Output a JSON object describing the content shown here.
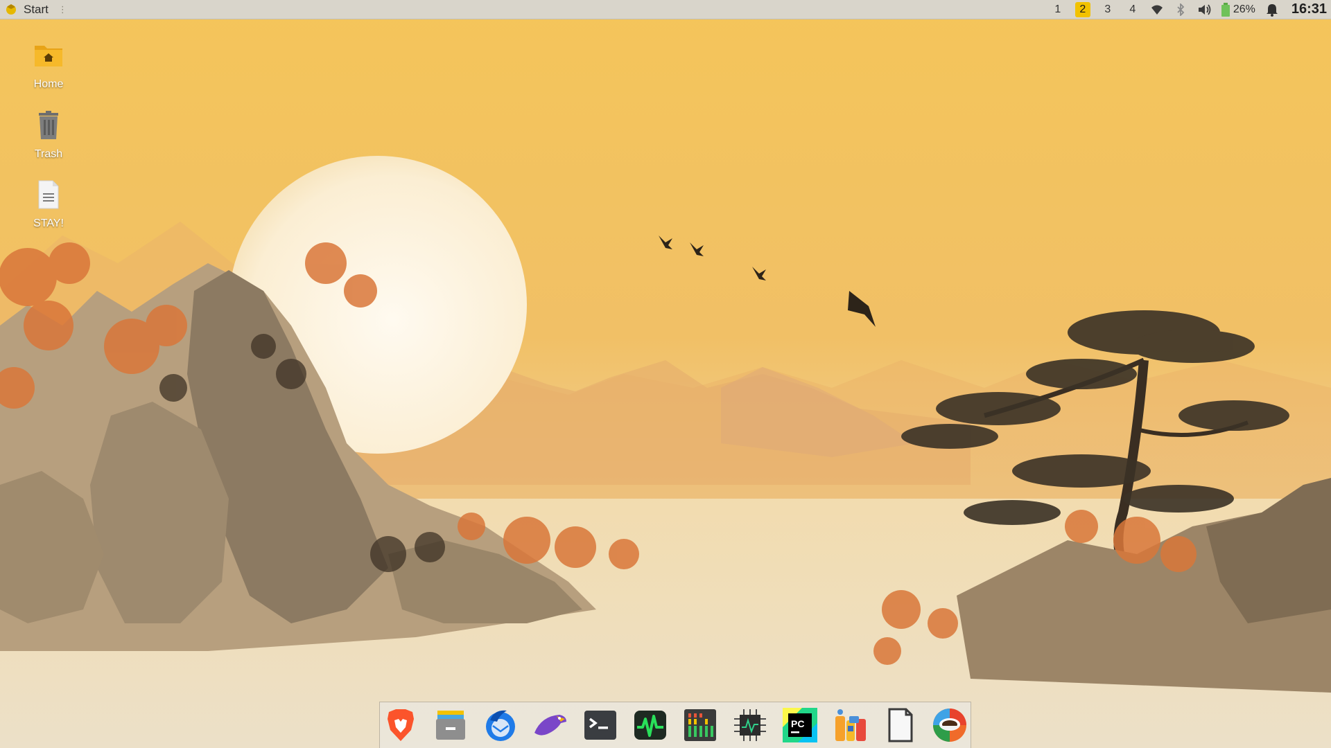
{
  "panel": {
    "start_label": "Start",
    "workspaces": [
      "1",
      "2",
      "3",
      "4"
    ],
    "active_workspace": "2",
    "battery_percent": "26%",
    "clock": "16:31",
    "tray_icons": [
      "wifi-icon",
      "bluetooth-icon",
      "volume-icon",
      "battery-icon",
      "notification-bell-icon"
    ]
  },
  "desktop_icons": [
    {
      "label": "Home",
      "icon": "home-folder-icon"
    },
    {
      "label": "Trash",
      "icon": "trash-icon"
    },
    {
      "label": "STAY!",
      "icon": "text-file-icon"
    }
  ],
  "dock_apps": [
    "brave-browser-icon",
    "file-manager-icon",
    "thunderbird-mail-icon",
    "eagle-app-icon",
    "terminal-icon",
    "system-monitor-icon",
    "htop-meter-icon",
    "cpu-monitor-icon",
    "pycharm-icon",
    "app-store-icon",
    "text-editor-icon",
    "coffee-app-icon"
  ],
  "colors": {
    "panel_bg": "#d9d5cb",
    "active_workspace": "#f2c200",
    "sky": "#f2bf4e",
    "moon": "#fdf6e3"
  }
}
